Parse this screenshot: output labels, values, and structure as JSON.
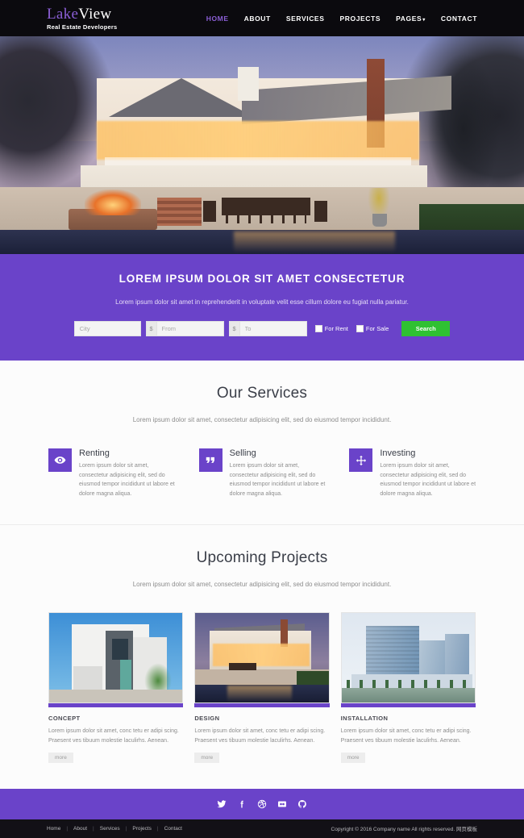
{
  "header": {
    "logo_lake": "Lake",
    "logo_view": "View",
    "logo_sub": "Real Estate Developers",
    "nav": [
      {
        "label": "HOME",
        "active": true
      },
      {
        "label": "ABOUT",
        "active": false
      },
      {
        "label": "SERVICES",
        "active": false
      },
      {
        "label": "PROJECTS",
        "active": false
      },
      {
        "label": "PAGES",
        "active": false,
        "caret": "▾"
      },
      {
        "label": "CONTACT",
        "active": false
      }
    ]
  },
  "banner": {
    "title": "LOREM IPSUM DOLOR SIT AMET CONSECTETUR",
    "subtitle": "Lorem ipsum dolor sit amet in reprehenderit in voluptate velit esse cillum dolore eu fugiat nulla pariatur.",
    "city_placeholder": "City",
    "from_placeholder": "From",
    "to_placeholder": "To",
    "currency_symbol": "$",
    "for_rent_label": "For Rent",
    "for_sale_label": "For Sale",
    "search_label": "Search",
    "accent_color": "#6a43c9",
    "search_button_color": "#2fc132"
  },
  "services": {
    "title": "Our Services",
    "subtitle": "Lorem ipsum dolor sit amet, consectetur adipisicing elit, sed do eiusmod tempor incididunt.",
    "items": [
      {
        "icon": "eye-icon",
        "title": "Renting",
        "text": "Lorem ipsum dolor sit amet, consectetur adipisicing elit, sed do eiusmod tempor incididunt ut labore et dolore magna aliqua."
      },
      {
        "icon": "quote-icon",
        "title": "Selling",
        "text": "Lorem ipsum dolor sit amet, consectetur adipisicing elit, sed do eiusmod tempor incididunt ut labore et dolore magna aliqua."
      },
      {
        "icon": "move-arrows-icon",
        "title": "Investing",
        "text": "Lorem ipsum dolor sit amet, consectetur adipisicing elit, sed do eiusmod tempor incididunt ut labore et dolore magna aliqua."
      }
    ]
  },
  "projects": {
    "title": "Upcoming Projects",
    "subtitle": "Lorem ipsum dolor sit amet, consectetur adipisicing elit, sed do eiusmod tempor incididunt.",
    "items": [
      {
        "title": "CONCEPT",
        "text": "Lorem ipsum dolor sit amet, conc tetu er adipi scing. Praesent ves tibuum molestie laculirhs. Aenean.",
        "more_label": "more",
        "image": "modern-white-house-photo"
      },
      {
        "title": "DESIGN",
        "text": "Lorem ipsum dolor sit amet, conc tetu er adipi scing. Praesent ves tibuum molestie laculirhs. Aenean.",
        "more_label": "more",
        "image": "dusk-house-pool-photo"
      },
      {
        "title": "INSTALLATION",
        "text": "Lorem ipsum dolor sit amet, conc tetu er adipi scing. Praesent ves tibuum molestie laculirhs. Aenean.",
        "more_label": "more",
        "image": "glass-office-towers-photo"
      }
    ]
  },
  "footer": {
    "social": [
      {
        "name": "twitter-icon",
        "glyph": "🐦"
      },
      {
        "name": "facebook-icon",
        "glyph": "f"
      },
      {
        "name": "dribbble-icon",
        "glyph": "◉"
      },
      {
        "name": "flickr-icon",
        "glyph": "▪▪"
      },
      {
        "name": "github-icon",
        "glyph": "◐"
      }
    ],
    "links": [
      "Home",
      "About",
      "Services",
      "Projects",
      "Contact"
    ],
    "separator": "|",
    "copyright": "Copyright © 2016 Company name All rights reserved. 网页模板"
  }
}
